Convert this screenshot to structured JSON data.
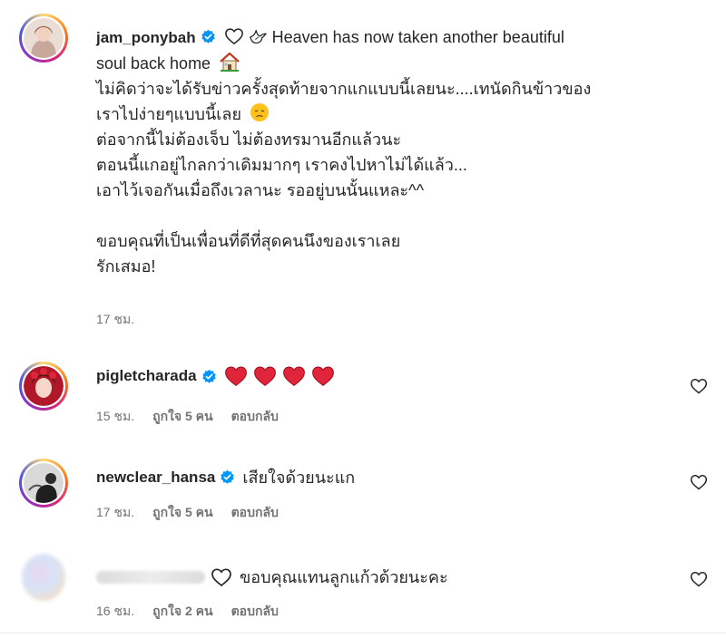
{
  "main_comment": {
    "username": "jam_ponybah",
    "caption_line_1": "Heaven has now taken another beautiful",
    "caption_line_2": "soul back home",
    "lines": [
      "ไม่คิดว่าจะได้รับข่าวครั้งสุดท้ายจากแกแบบนี้เลยนะ....เทนัดกินข้าวของ",
      "เราไปง่ายๆแบบนี้เลย",
      "ต่อจากนี้ไม่ต้องเจ็บ ไม่ต้องทรมานอีกแล้วนะ",
      "ตอนนี้แกอยู่ไกลกว่าเดิมมากๆ เราคงไปหาไม่ได้แล้ว...",
      "เอาไว้เจอกันเมื่อถึงเวลานะ รออยู่บนนั้นแหละ^^",
      "ขอบคุณที่เป็นเพื่อนที่ดีที่สุดคนนึงของเราเลย",
      "รักเสมอ!"
    ],
    "time": "17 ชม."
  },
  "replies": [
    {
      "username": "pigletcharada",
      "text": "",
      "time": "15 ชม.",
      "likes": "ถูกใจ 5 คน",
      "reply_label": "ตอบกลับ"
    },
    {
      "username": "newclear_hansa",
      "text": "เสียใจด้วยนะแก",
      "time": "17 ชม.",
      "likes": "ถูกใจ 5 คน",
      "reply_label": "ตอบกลับ"
    },
    {
      "username": "",
      "text": "ขอบคุณแทนลูกแก้วด้วยนะคะ",
      "time": "16 ชม.",
      "likes": "ถูกใจ 2 คน",
      "reply_label": "ตอบกลับ"
    }
  ],
  "colors": {
    "verified": "#0095f6",
    "heart_red": "#e0243a",
    "meta_grey": "#737373"
  },
  "icons": [
    "verified-badge-icon",
    "heart-outline-icon",
    "dove-icon",
    "house-icon",
    "sad-face-emoji",
    "red-heart-emoji",
    "like-heart-icon"
  ]
}
